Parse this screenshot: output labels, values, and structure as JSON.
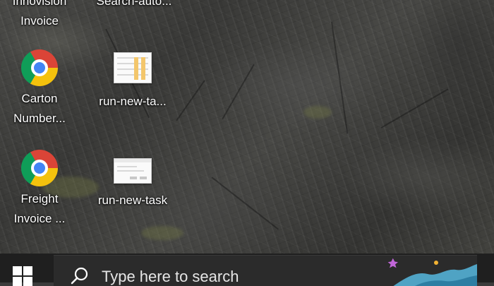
{
  "desktop": {
    "icons": [
      {
        "name": "innovision-invoice",
        "type": "chrome",
        "label": "Innovision\nInvoice"
      },
      {
        "name": "search-auto",
        "type": "excel",
        "label": "Search-auto..."
      },
      {
        "name": "carton-number",
        "type": "chrome",
        "label": "Carton\nNumber..."
      },
      {
        "name": "run-new-task-1",
        "type": "excel",
        "label": "run-new-ta..."
      },
      {
        "name": "freight-invoice",
        "type": "chrome",
        "label": "Freight\nInvoice ..."
      },
      {
        "name": "run-new-task-2",
        "type": "dialog",
        "label": "run-new-task"
      }
    ]
  },
  "taskbar": {
    "start_icon": "windows-logo-icon",
    "search": {
      "icon": "search-icon",
      "placeholder": "Type here to search"
    }
  },
  "colors": {
    "taskbar_bg": "#1f1f1f",
    "search_bg": "#2b2b2b",
    "icon_label": "#ffffff"
  }
}
